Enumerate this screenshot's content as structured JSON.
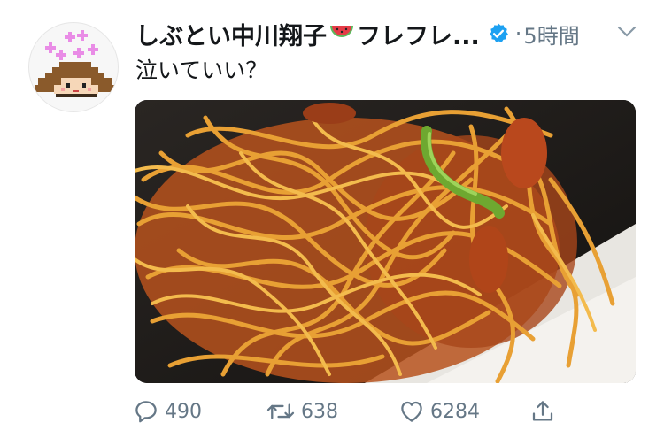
{
  "tweet": {
    "display_name": "しぶとい中川翔子",
    "display_name_suffix": "フレフレ...",
    "emoji_icon": "watermelon-icon",
    "verified_icon": "verified-badge-icon",
    "time_separator": "·",
    "timestamp": "5時間",
    "text": "泣いていい？",
    "menu_icon": "chevron-down-icon"
  },
  "actions": {
    "reply_count": "490",
    "retweet_count": "638",
    "like_count": "6284"
  },
  "colors": {
    "text": "#14171a",
    "secondary": "#657786",
    "verified": "#1da1f2"
  }
}
